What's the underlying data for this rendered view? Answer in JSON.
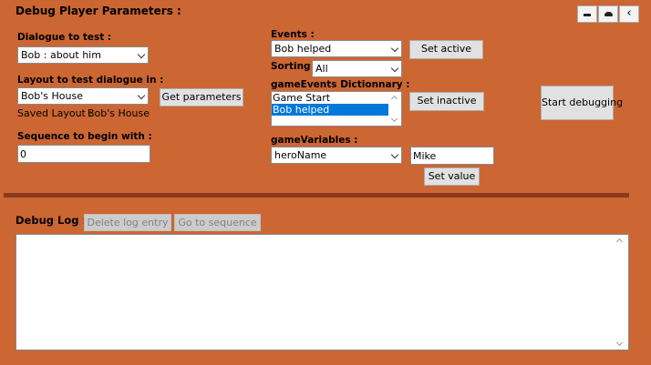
{
  "header": {
    "title": "Debug Player Parameters :"
  },
  "window_controls": [
    {
      "name": "pin-icon",
      "glyph": "▬"
    },
    {
      "name": "cloud-icon",
      "glyph": "☁"
    },
    {
      "name": "chevron-left-icon",
      "glyph": "‹"
    }
  ],
  "dialogue": {
    "label": "Dialogue to test :",
    "selected": "Bob : about him"
  },
  "layout": {
    "label": "Layout to test dialogue in :",
    "selected": "Bob's House",
    "saved_label": "Saved Layout :",
    "saved_value": "Bob's House"
  },
  "get_parameters_label": "Get parameters",
  "sequence": {
    "label": "Sequence to begin with :",
    "value": "0"
  },
  "events": {
    "label": "Events :",
    "selected": "Bob helped",
    "set_active_label": "Set active"
  },
  "sorting": {
    "label": "Sorting :",
    "selected": "All"
  },
  "game_events": {
    "label": "gameEvents Dictionnary :",
    "items": [
      "Game Start",
      "Bob helped"
    ],
    "set_inactive_label": "Set inactive"
  },
  "start_debugging_label": "Start debugging",
  "game_variables": {
    "label": "gameVariables :",
    "selected": "heroName",
    "value": "Mike",
    "set_value_label": "Set value"
  },
  "debug_log": {
    "label": "Debug Log :",
    "delete_label": "Delete log entry",
    "goto_label": "Go to sequence",
    "content": ""
  },
  "colors": {
    "background": "#cc6633",
    "separator": "#8b3a1a",
    "selection": "#0078d7"
  }
}
